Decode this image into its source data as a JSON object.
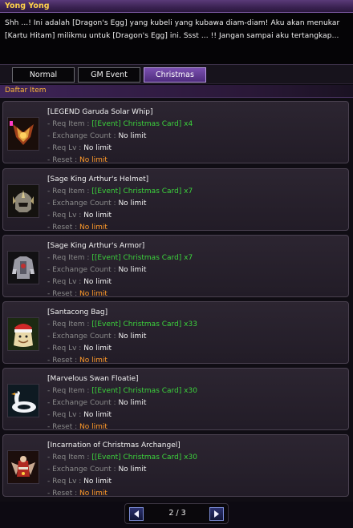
{
  "window": {
    "title": "Yong Yong"
  },
  "dialog": {
    "line1": "Shh ...! Ini adalah [Dragon's Egg] yang kubeli yang kubawa diam-diam! Aku akan menukar",
    "line2": "[Kartu Hitam] milikmu untuk [Dragon's Egg] ini. Ssst ... !! Jangan sampai aku tertangkap..."
  },
  "tabs": [
    {
      "label": "Normal",
      "active": false
    },
    {
      "label": "GM Event",
      "active": false
    },
    {
      "label": "Christmas",
      "active": true
    }
  ],
  "section": {
    "title": "Daftar Item"
  },
  "labels": {
    "req_item": "- Req Item :",
    "exchange_count": "- Exchange Count :",
    "req_lv": "- Req Lv :",
    "reset": "- Reset :"
  },
  "items": [
    {
      "name": "[LEGEND Garuda Solar Whip]",
      "icon": "garuda-whip-icon",
      "req_item": "[[Event] Christmas Card] x4",
      "exchange_count": "No limit",
      "req_lv": "No limit",
      "reset": "No limit"
    },
    {
      "name": "[Sage King Arthur's Helmet]",
      "icon": "helmet-icon",
      "req_item": "[[Event] Christmas Card] x7",
      "exchange_count": "No limit",
      "req_lv": "No limit",
      "reset": "No limit"
    },
    {
      "name": "[Sage King Arthur's Armor]",
      "icon": "armor-icon",
      "req_item": "[[Event] Christmas Card] x7",
      "exchange_count": "No limit",
      "req_lv": "No limit",
      "reset": "No limit"
    },
    {
      "name": "[Santacong Bag]",
      "icon": "santa-bag-icon",
      "req_item": "[[Event] Christmas Card] x33",
      "exchange_count": "No limit",
      "req_lv": "No limit",
      "reset": "No limit"
    },
    {
      "name": "[Marvelous Swan Floatie]",
      "icon": "swan-floatie-icon",
      "req_item": "[[Event] Christmas Card] x30",
      "exchange_count": "No limit",
      "req_lv": "No limit",
      "reset": "No limit"
    },
    {
      "name": "[Incarnation of Christmas Archangel]",
      "icon": "archangel-icon",
      "req_item": "[[Event] Christmas Card] x30",
      "exchange_count": "No limit",
      "req_lv": "No limit",
      "reset": "No limit"
    }
  ],
  "pager": {
    "text": "2 / 3"
  }
}
